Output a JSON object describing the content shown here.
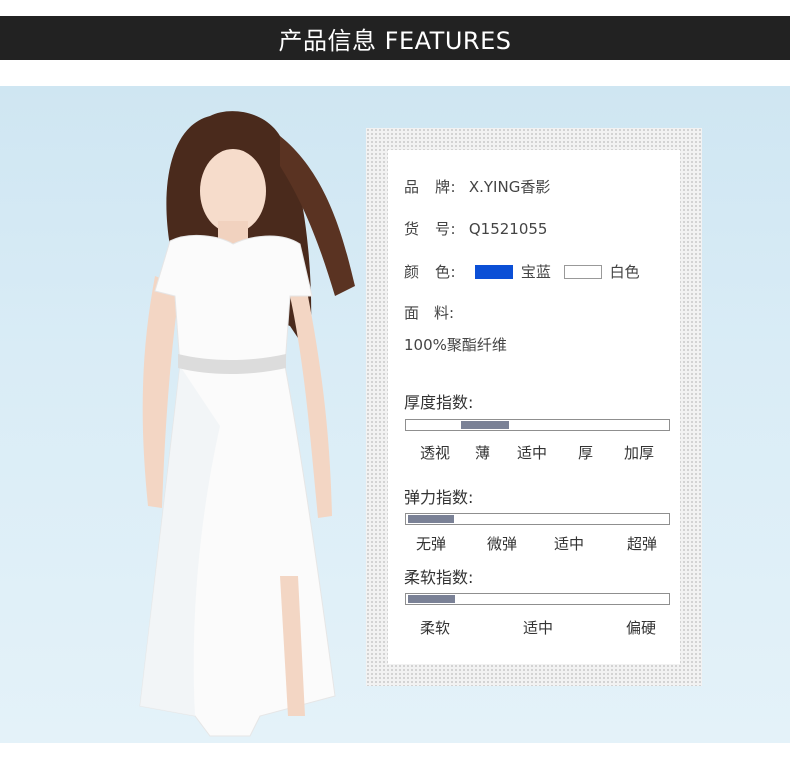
{
  "header": {
    "title": "产品信息 FEATURES"
  },
  "product": {
    "brand_label": "品　牌:",
    "brand_value": "X.YING香影",
    "sku_label": "货　号:",
    "sku_value": "Q1521055",
    "color_label": "颜　色:",
    "colors": [
      {
        "name": "宝蓝",
        "hex": "#0b4fd6"
      },
      {
        "name": "白色",
        "hex": "#ffffff"
      }
    ],
    "fabric_label": "面　料:",
    "fabric_value": "100%聚酯纤维"
  },
  "indices": {
    "thickness": {
      "title": "厚度指数:",
      "levels": [
        "透视",
        "薄",
        "适中",
        "厚",
        "加厚"
      ],
      "selected": "薄"
    },
    "elasticity": {
      "title": "弹力指数:",
      "levels": [
        "无弹",
        "微弹",
        "适中",
        "超弹"
      ],
      "selected": "无弹"
    },
    "softness": {
      "title": "柔软指数:",
      "levels": [
        "柔软",
        "适中",
        "偏硬"
      ],
      "selected": "柔软"
    }
  },
  "colors": {
    "header_bg": "#222222",
    "indicator": "#7a8196",
    "photo_bg": "#d9ecf6"
  }
}
